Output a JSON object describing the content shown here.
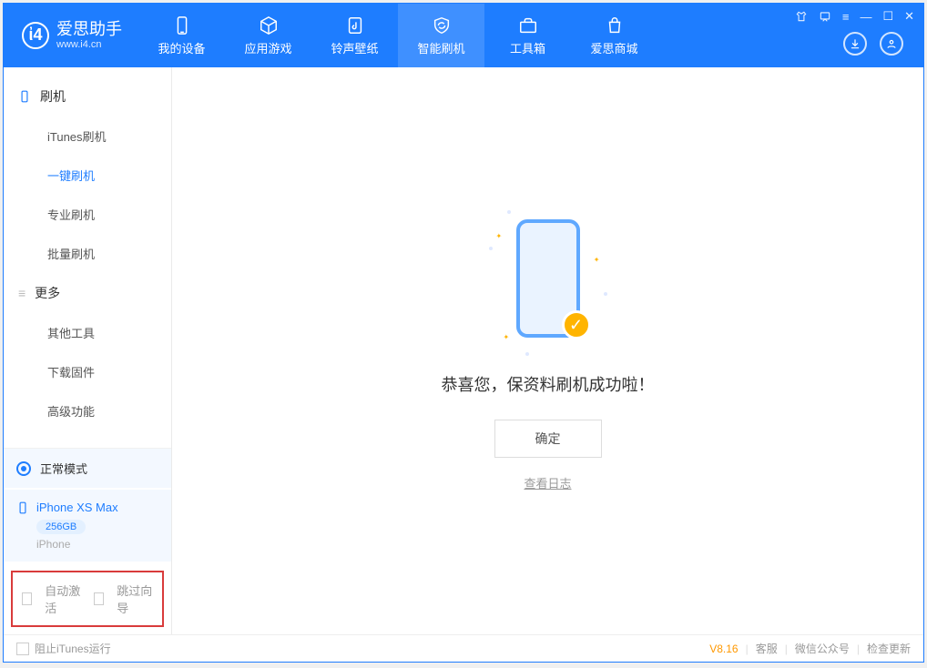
{
  "app": {
    "name": "爱思助手",
    "url": "www.i4.cn"
  },
  "nav": {
    "tabs": [
      {
        "label": "我的设备"
      },
      {
        "label": "应用游戏"
      },
      {
        "label": "铃声壁纸"
      },
      {
        "label": "智能刷机"
      },
      {
        "label": "工具箱"
      },
      {
        "label": "爱思商城"
      }
    ]
  },
  "sidebar": {
    "section_flash": "刷机",
    "items_flash": [
      {
        "label": "iTunes刷机"
      },
      {
        "label": "一键刷机"
      },
      {
        "label": "专业刷机"
      },
      {
        "label": "批量刷机"
      }
    ],
    "section_more": "更多",
    "items_more": [
      {
        "label": "其他工具"
      },
      {
        "label": "下载固件"
      },
      {
        "label": "高级功能"
      }
    ],
    "mode_label": "正常模式",
    "device_name": "iPhone XS Max",
    "device_capacity": "256GB",
    "device_type": "iPhone",
    "chk_auto_activate": "自动激活",
    "chk_skip_guide": "跳过向导"
  },
  "main": {
    "success_msg": "恭喜您，保资料刷机成功啦！",
    "ok_label": "确定",
    "view_log": "查看日志"
  },
  "statusbar": {
    "block_itunes": "阻止iTunes运行",
    "version": "V8.16",
    "links": [
      "客服",
      "微信公众号",
      "检查更新"
    ]
  }
}
